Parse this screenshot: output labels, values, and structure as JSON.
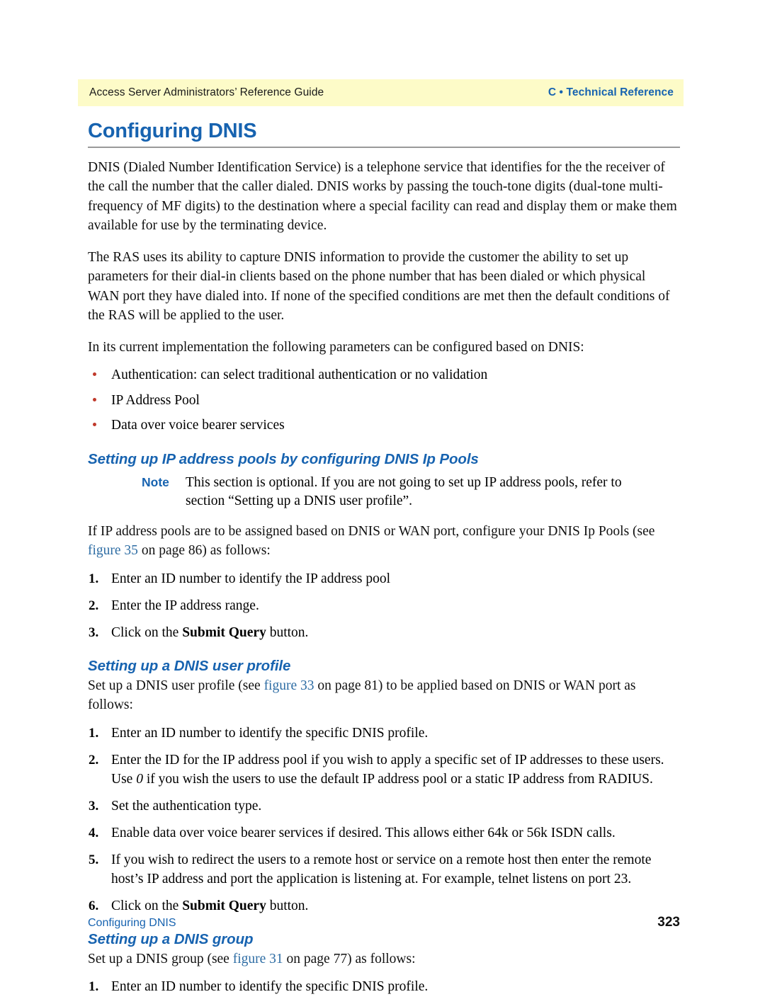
{
  "header": {
    "left_text": "Access Server Administrators’ Reference Guide",
    "right_text": "C • Technical Reference",
    "band_color": "#fdfbc8",
    "accent_color": "#1763b0"
  },
  "title": "Configuring DNIS",
  "paragraphs": {
    "intro": "DNIS (Dialed Number Identification Service) is a telephone service that identifies for the the receiver of the call the number that the caller dialed. DNIS works by passing the touch-tone digits (dual-tone multi-frequency of MF digits) to the destination where a special facility can read and display them or make them available for use by the terminating device.",
    "ras": "The RAS uses its ability to capture DNIS information to provide the customer the ability to set up parameters for their dial-in clients based on the phone number that has been dialed or which physical WAN port they have dialed into. If none of the specified conditions are met then the default conditions of the RAS will be applied to the user.",
    "current_impl": "In its current implementation the following parameters can be configured based on DNIS:"
  },
  "bullets": [
    "Authentication: can select traditional authentication or no validation",
    "IP Address Pool",
    "Data over voice bearer services"
  ],
  "section_ippools": {
    "heading": "Setting up IP address pools by configuring DNIS Ip Pools",
    "note_label": "Note",
    "note_text": "This section is optional. If you are not going to set up IP address pools, refer to section “Setting up a DNIS user profile”.",
    "intro_before_link": "If IP address pools are to be assigned based on DNIS or WAN port, configure your DNIS Ip Pools (see ",
    "intro_link": "figure 35",
    "intro_after_link": " on page 86) as follows:",
    "steps": [
      {
        "num": "1.",
        "text": "Enter an ID number to identify the IP address pool"
      },
      {
        "num": "2.",
        "text": "Enter the IP address range."
      },
      {
        "num": "3.",
        "before": "Click on the ",
        "bold": "Submit Query",
        "after": " button."
      }
    ]
  },
  "section_userprofile": {
    "heading": "Setting up a DNIS user profile",
    "intro_before_link": "Set up a DNIS user profile (see ",
    "intro_link": "figure 33",
    "intro_after_link": " on page 81) to be applied based on DNIS or WAN port as follows:",
    "steps": [
      {
        "num": "1.",
        "text": "Enter an ID number to identify the specific DNIS profile."
      },
      {
        "num": "2.",
        "before": "Enter the ID for the IP address pool if you wish to apply a specific set of IP addresses to these users.  Use ",
        "italic": "0",
        "after": " if you wish the users to use the default IP address pool or a static IP address from RADIUS."
      },
      {
        "num": "3.",
        "text": "Set the authentication type."
      },
      {
        "num": "4.",
        "text": "Enable data over voice bearer services if desired. This allows either 64k or 56k ISDN calls."
      },
      {
        "num": "5.",
        "text": "If you wish to redirect the users to a remote host or service on a remote host then enter the remote host’s IP address and port the application is listening at. For example, telnet listens on port 23."
      },
      {
        "num": "6.",
        "before": "Click on the ",
        "bold": "Submit Query",
        "after": " button."
      }
    ]
  },
  "section_group": {
    "heading": "Setting up a DNIS group",
    "intro_before_link": "Set up a DNIS group (see ",
    "intro_link": "figure 31",
    "intro_after_link": " on page 77) as follows:",
    "steps": [
      {
        "num": "1.",
        "text": "Enter an ID number to identify the specific DNIS profile."
      }
    ]
  },
  "footer": {
    "left_text": "Configuring DNIS",
    "page_number": "323"
  }
}
